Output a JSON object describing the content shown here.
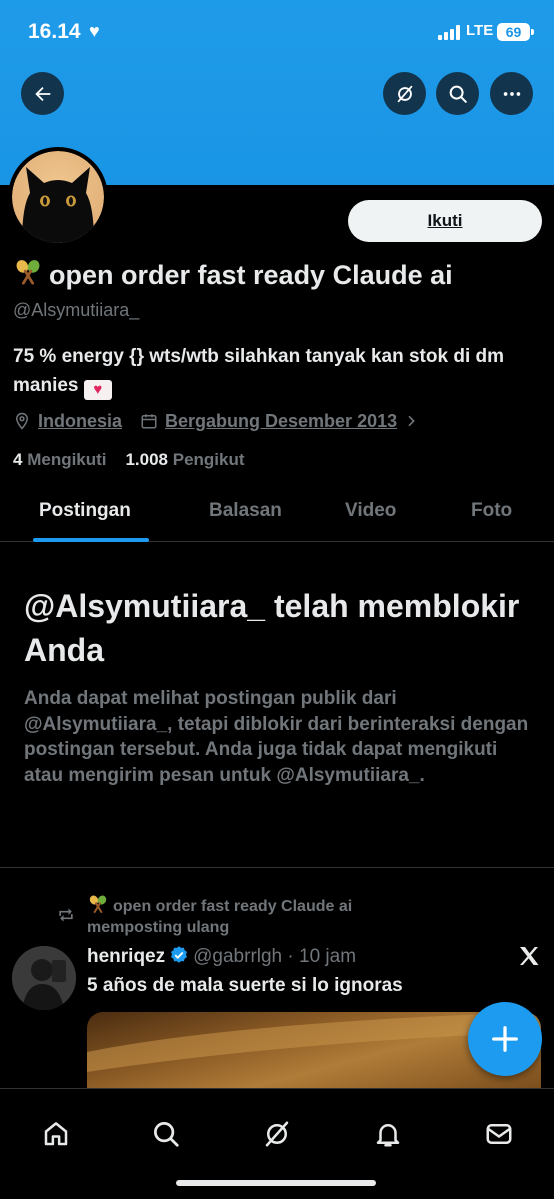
{
  "status_bar": {
    "time": "16.14",
    "network": "LTE",
    "battery": "69"
  },
  "header": {
    "back_icon": "arrow-left-icon",
    "actions": [
      "grok-icon",
      "search-icon",
      "more-icon"
    ]
  },
  "profile": {
    "follow_label": "Ikuti",
    "display_name": "open order fast ready Claude ai",
    "handle": "@Alsymutiiara_",
    "bio": "75 % energy {} wts/wtb silahkan tanyak kan stok di dm manies",
    "location": "Indonesia",
    "joined": "Bergabung Desember 2013",
    "following_count": "4",
    "following_label": "Mengikuti",
    "followers_count": "1.008",
    "followers_label": "Pengikut"
  },
  "tabs": [
    {
      "label": "Postingan",
      "active": true
    },
    {
      "label": "Balasan",
      "active": false
    },
    {
      "label": "Video",
      "active": false
    },
    {
      "label": "Foto",
      "active": false
    }
  ],
  "blocked": {
    "title": "@Alsymutiiara_ telah memblokir Anda",
    "description": "Anda dapat melihat postingan publik dari @Alsymutiiara_, tetapi diblokir dari berinteraksi dengan postingan tersebut. Anda juga tidak dapat mengikuti atau mengirim pesan untuk @Alsymutiiara_."
  },
  "repost": {
    "text": "open order fast ready Claude ai memposting ulang",
    "tweet": {
      "name": "henriqez",
      "handle": "@gabrrlgh",
      "time": "· 10 jam",
      "text": "5 años de mala suerte si lo ignoras"
    }
  },
  "bottom_nav": [
    "home-icon",
    "search-icon",
    "grok-icon",
    "notifications-icon",
    "messages-icon"
  ],
  "colors": {
    "accent": "#1d9bf0",
    "banner": "#1a95e6",
    "background": "#000000",
    "muted": "#71767b"
  }
}
